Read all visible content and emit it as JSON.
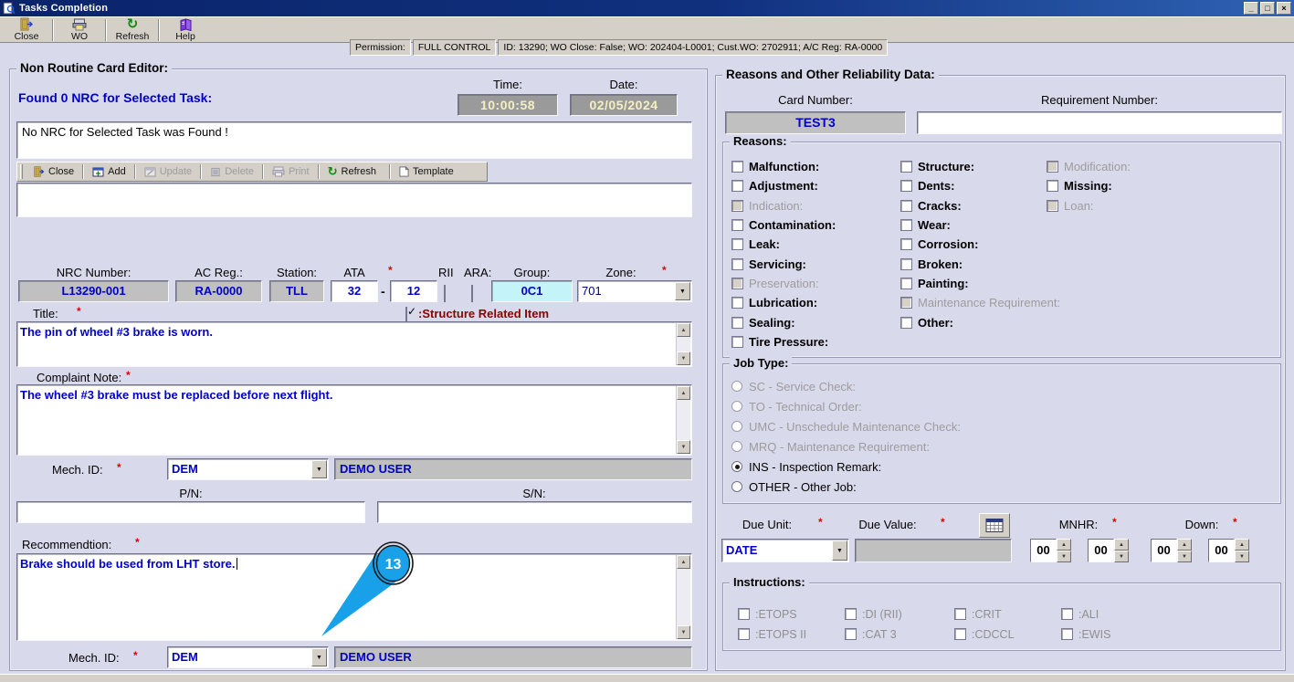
{
  "window": {
    "title": "Tasks Completion",
    "controls": {
      "minimize": "_",
      "restore": "□",
      "close": "×"
    }
  },
  "icons": {
    "arrow_up": "▲",
    "arrow_down": "▼",
    "dropdown": "▼",
    "check": "✓",
    "refresh": "↻"
  },
  "misc": {
    "asterisk": "*",
    "ata_dash": "-"
  },
  "toolbar": {
    "buttons": [
      {
        "label": "Close"
      },
      {
        "label": "WO"
      },
      {
        "label": "Refresh"
      },
      {
        "label": "Help"
      }
    ],
    "permission_label": "Permission:",
    "permission_value": "FULL CONTROL",
    "context_info": "ID: 13290; WO Close: False; WO: 202404-L0001; Cust.WO: 2702911; A/C Reg: RA-0000"
  },
  "nrc_editor": {
    "group_title": "Non Routine Card Editor:",
    "found_text": "Found 0 NRC for Selected Task:",
    "time_label": "Time:",
    "time_value": "10:00:58",
    "date_label": "Date:",
    "date_value": "02/05/2024",
    "list_message": "No NRC for Selected Task was Found !",
    "inner_toolbar": [
      {
        "label": "Close",
        "enabled": true
      },
      {
        "label": "Add",
        "enabled": true
      },
      {
        "label": "Update",
        "enabled": false
      },
      {
        "label": "Delete",
        "enabled": false
      },
      {
        "label": "Print",
        "enabled": false
      },
      {
        "label": "Refresh",
        "enabled": true
      },
      {
        "label": "Template",
        "enabled": true
      }
    ],
    "fields": {
      "nrc_number_label": "NRC Number:",
      "nrc_number": "L13290-001",
      "ac_reg_label": "AC Reg.:",
      "ac_reg": "RA-0000",
      "station_label": "Station:",
      "station": "TLL",
      "ata_label": "ATA",
      "ata_major": "32",
      "ata_minor": "12",
      "rii_label": "RII",
      "ara_label": "ARA:",
      "group_label": "Group:",
      "group_value": "0C1",
      "zone_label": "Zone:",
      "zone_value": "701"
    },
    "title_label": "Title:",
    "structure_item_label": ":Structure Related Item",
    "title_text": "The pin of wheel #3 brake is worn.",
    "complaint_label": "Complaint Note:",
    "complaint_text": "The wheel #3 brake must be replaced before next flight.",
    "mech_id_label": "Mech. ID:",
    "mech_id_value": "DEM",
    "mech_user": "DEMO USER",
    "pn_label": "P/N:",
    "sn_label": "S/N:",
    "recommendation_label": "Recommendtion:",
    "recommendation_text": "Brake should be used from LHT store.",
    "mech_id2_label": "Mech. ID:",
    "mech_id2_value": "DEM",
    "mech_user2": "DEMO USER"
  },
  "reliability": {
    "group_title": "Reasons and Other Reliability Data:",
    "card_number_label": "Card Number:",
    "card_number_value": "TEST3",
    "requirement_label": "Requirement Number:",
    "requirement_value": "",
    "reasons": {
      "title": "Reasons:",
      "columns": [
        [
          {
            "label": "Malfunction:",
            "disabled": false
          },
          {
            "label": "Adjustment:",
            "disabled": false
          },
          {
            "label": "Indication:",
            "disabled": true
          },
          {
            "label": "Contamination:",
            "disabled": false
          },
          {
            "label": "Leak:",
            "disabled": false
          },
          {
            "label": "Servicing:",
            "disabled": false
          },
          {
            "label": "Preservation:",
            "disabled": true
          },
          {
            "label": "Lubrication:",
            "disabled": false
          },
          {
            "label": "Sealing:",
            "disabled": false
          },
          {
            "label": "Tire Pressure:",
            "disabled": false
          }
        ],
        [
          {
            "label": "Structure:",
            "disabled": false
          },
          {
            "label": "Dents:",
            "disabled": false
          },
          {
            "label": "Cracks:",
            "disabled": false
          },
          {
            "label": "Wear:",
            "disabled": false
          },
          {
            "label": "Corrosion:",
            "disabled": false
          },
          {
            "label": "Broken:",
            "disabled": false
          },
          {
            "label": "Painting:",
            "disabled": false
          },
          {
            "label": "Maintenance Requirement:",
            "disabled": true
          },
          {
            "label": "Other:",
            "disabled": false
          }
        ],
        [
          {
            "label": "Modification:",
            "disabled": true
          },
          {
            "label": "Missing:",
            "disabled": false
          },
          {
            "label": "Loan:",
            "disabled": true
          }
        ]
      ]
    },
    "job_type": {
      "title": "Job Type:",
      "options": [
        {
          "label": "SC - Service Check:",
          "disabled": true,
          "selected": false
        },
        {
          "label": "TO - Technical Order:",
          "disabled": true,
          "selected": false
        },
        {
          "label": "UMC - Unschedule Maintenance Check:",
          "disabled": true,
          "selected": false
        },
        {
          "label": "MRQ - Maintenance Requirement:",
          "disabled": true,
          "selected": false
        },
        {
          "label": "INS - Inspection Remark:",
          "disabled": false,
          "selected": true
        },
        {
          "label": "OTHER - Other Job:",
          "disabled": false,
          "selected": false
        }
      ]
    },
    "due": {
      "due_unit_label": "Due Unit:",
      "due_unit_value": "DATE",
      "due_value_label": "Due Value:",
      "due_value": "",
      "mnhr_label": "MNHR:",
      "down_label": "Down:",
      "spinners": [
        "00",
        "00",
        "00",
        "00"
      ]
    },
    "instructions": {
      "title": "Instructions:",
      "items": [
        ":ETOPS",
        ":DI (RII)",
        ":CRIT",
        ":ALI",
        ":ETOPS II",
        ":CAT 3",
        ":CDCCL",
        ":EWIS"
      ]
    }
  },
  "callout": {
    "number": "13",
    "color": "#18a0e8"
  },
  "colors": {
    "value_text": "#0000c8",
    "alert_text": "#8b0000",
    "required": "#e80000",
    "field_gray": "#c0c0c0",
    "field_cyan": "#c4f4f8",
    "clock_bg": "#9a9a9a",
    "clock_text": "#f5f0c0"
  }
}
